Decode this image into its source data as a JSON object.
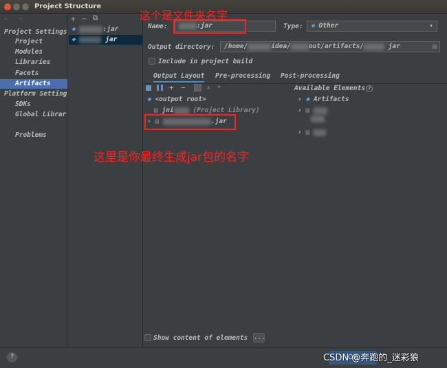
{
  "window": {
    "title": "Project Structure"
  },
  "nav": {
    "arrows": "← →",
    "project_settings_header": "Project Settings",
    "project_settings_items": [
      "Project",
      "Modules",
      "Libraries",
      "Facets",
      "Artifacts"
    ],
    "selected_item": "Artifacts",
    "platform_settings_header": "Platform Setting",
    "platform_settings_items": [
      "SDKs",
      "Global Librar"
    ],
    "problems_label": "Problems"
  },
  "artifact_list": {
    "toolbar": {
      "add": "+",
      "remove": "−",
      "copy": "⧉"
    },
    "items": [
      ":jar",
      "jar"
    ]
  },
  "form": {
    "name_label": "Name:",
    "name_value": ":jar",
    "type_label": "Type:",
    "type_value": "Other",
    "output_dir_label": "Output directory:",
    "output_dir_parts": [
      "/home/",
      "idea/",
      "out/artifacts/",
      "jar"
    ],
    "include_in_build_label": "Include in project build"
  },
  "tabs": [
    "Output Layout",
    "Pre-processing",
    "Post-processing"
  ],
  "layout_tree": {
    "output_root": "<output root>",
    "library_row_prefix": "jni",
    "library_row_suffix": "(Project Library)",
    "jar_row_suffix": ".jar"
  },
  "available": {
    "header": "Available Elements",
    "help_glyph": "?",
    "artifacts_label": "Artifacts"
  },
  "bottom": {
    "show_content_label": "Show content of elements",
    "ellipsis": "...",
    "help": "?",
    "ok_label": "OK",
    "watermark": "CSDN @奔跑的_迷彩狼"
  },
  "annotations": {
    "folder_name_note": "这个是文件夹名字",
    "jar_name_note": "这里是你最终生成jar包的名字",
    "highlight_color": "#ff2020"
  }
}
